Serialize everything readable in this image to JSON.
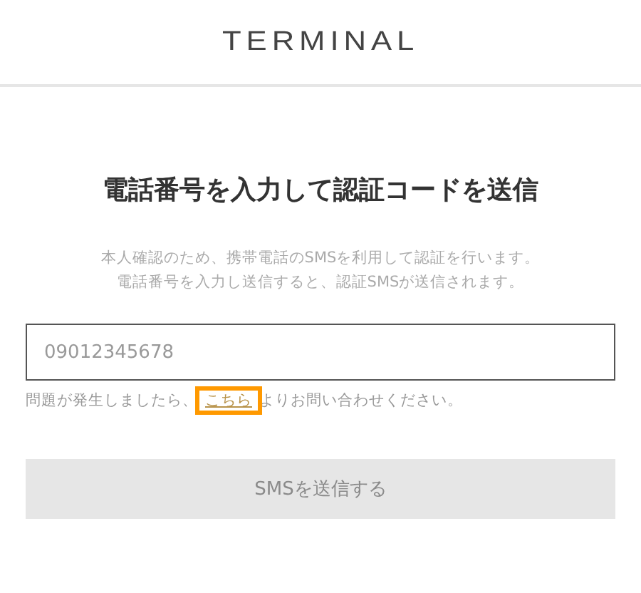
{
  "header": {
    "logo": "TERMINAL"
  },
  "title": "電話番号を入力して認証コードを送信",
  "description": [
    "本人確認のため、携帯電話のSMSを利用して認証を行います。",
    "電話番号を入力し送信すると、認証SMSが送信されます。"
  ],
  "phone_field": {
    "placeholder": "09012345678"
  },
  "help": {
    "before": "問題が発生しましたら、",
    "link": "こちら",
    "link_highlighted": true,
    "after": "よりお問い合わせください。"
  },
  "submit_button": {
    "label": "SMSを送信する",
    "disabled": true
  }
}
